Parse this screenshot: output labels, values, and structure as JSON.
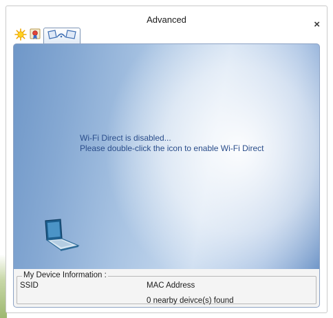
{
  "window": {
    "title": "Advanced",
    "close_symbol": "×"
  },
  "tabs": [
    {
      "icon": "sun-icon",
      "label": ""
    },
    {
      "icon": "certificate-icon",
      "label": ""
    },
    {
      "icon": "wifi-direct-icon",
      "label": "",
      "selected": true
    }
  ],
  "status": {
    "line1": "Wi-Fi Direct is disabled...",
    "line2": "Please double-click the icon to enable Wi-Fi Direct"
  },
  "device": {
    "icon": "laptop-icon"
  },
  "device_info": {
    "legend": "My Device Information :",
    "ssid_label": "SSID",
    "mac_label": "MAC Address",
    "nearby_text": "0 nearby deivce(s) found"
  },
  "colors": {
    "panel_blue": "#86a9d3",
    "status_text": "#2a4d8a",
    "tab_border": "#7d95b5"
  }
}
